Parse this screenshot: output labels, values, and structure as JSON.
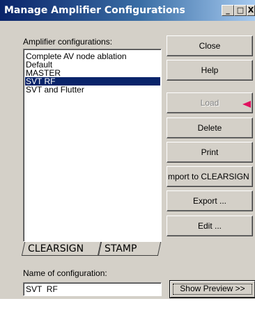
{
  "window": {
    "title": "Manage Amplifier Configurations",
    "minimize_glyph": "_",
    "maximize_glyph": "□",
    "close_glyph": "X"
  },
  "config_list": {
    "label": "Amplifier configurations:",
    "items": [
      {
        "label": "Complete AV node ablation",
        "selected": false
      },
      {
        "label": "Default",
        "selected": false
      },
      {
        "label": "MASTER",
        "selected": false
      },
      {
        "label": "SVT  RF",
        "selected": true
      },
      {
        "label": "SVT and Flutter",
        "selected": false
      }
    ]
  },
  "buttons": {
    "close": "Close",
    "help": "Help",
    "load": "Load",
    "delete": "Delete",
    "print": "Print",
    "import": "mport to CLEARSIGN ...",
    "export": "Export ...",
    "edit": "Edit ...",
    "show_preview": "Show Preview >>"
  },
  "button_states": {
    "load_enabled": false
  },
  "tabs": [
    {
      "label": "CLEARSIGN",
      "active": true
    },
    {
      "label": "STAMP",
      "active": false
    }
  ],
  "name_field": {
    "label": "Name of configuration:",
    "value": "SVT  RF"
  },
  "colors": {
    "selection": "#0a246a",
    "titlebar_start": "#0a246a",
    "titlebar_end": "#a6caf0",
    "dialog_face": "#d4d0c8",
    "annotation_arrow": "#e0115f"
  },
  "icons": {
    "annotation": "arrow-left-icon"
  }
}
